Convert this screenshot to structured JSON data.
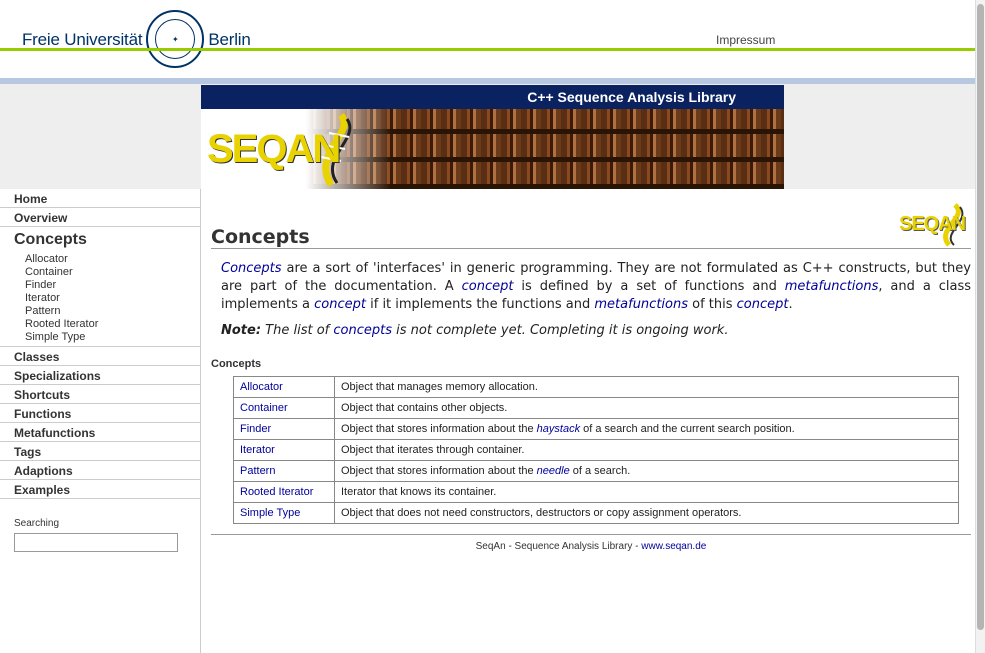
{
  "fu_header": {
    "university_left": "Freie Universität",
    "university_right": "Berlin",
    "impressum": "Impressum"
  },
  "banner": {
    "title": "C++ Sequence Analysis Library",
    "logo_text": "SEQAN"
  },
  "sidebar": {
    "items_top": [
      {
        "label": "Home"
      },
      {
        "label": "Overview"
      }
    ],
    "current": "Concepts",
    "sub_items": [
      {
        "label": "Allocator"
      },
      {
        "label": "Container"
      },
      {
        "label": "Finder"
      },
      {
        "label": "Iterator"
      },
      {
        "label": "Pattern"
      },
      {
        "label": "Rooted Iterator"
      },
      {
        "label": "Simple Type"
      }
    ],
    "items_bottom": [
      {
        "label": "Classes"
      },
      {
        "label": "Specializations"
      },
      {
        "label": "Shortcuts"
      },
      {
        "label": "Functions"
      },
      {
        "label": "Metafunctions"
      },
      {
        "label": "Tags"
      },
      {
        "label": "Adaptions"
      },
      {
        "label": "Examples"
      }
    ],
    "search_label": "Searching",
    "search_value": ""
  },
  "main": {
    "corner_logo": "SEQAN",
    "title": "Concepts",
    "intro": {
      "link_concepts": "Concepts",
      "t1": " are a sort of 'interfaces' in generic programming. They are not formulated as C++ constructs, but they are part of the documentation. A ",
      "link_concept": "concept",
      "t2": " is defined by a set of functions and ",
      "link_metafunctions": "metafunctions",
      "t3": ", and a class implements a ",
      "link_concept2": "concept",
      "t4": " if it implements the functions and ",
      "link_metafunctions2": "metafunctions",
      "t5": " of this ",
      "link_concept3": "concept",
      "t6": "."
    },
    "note": {
      "label": "Note:",
      "t1": " The list of ",
      "link": "concepts",
      "t2": " is not complete yet. Completing it is ongoing work."
    },
    "table_heading": "Concepts",
    "rows": [
      {
        "name": "Allocator",
        "desc_a": "Object that manages memory allocation.",
        "link": "",
        "desc_b": ""
      },
      {
        "name": "Container",
        "desc_a": "Object that contains other objects.",
        "link": "",
        "desc_b": ""
      },
      {
        "name": "Finder",
        "desc_a": "Object that stores information about the ",
        "link": "haystack",
        "desc_b": " of a search and the current search position."
      },
      {
        "name": "Iterator",
        "desc_a": "Object that iterates through container.",
        "link": "",
        "desc_b": ""
      },
      {
        "name": "Pattern",
        "desc_a": "Object that stores information about the ",
        "link": "needle",
        "desc_b": " of a search."
      },
      {
        "name": "Rooted Iterator",
        "desc_a": "Iterator that knows its container.",
        "link": "",
        "desc_b": ""
      },
      {
        "name": "Simple Type",
        "desc_a": "Object that does not need constructors, destructors or copy assignment operators.",
        "link": "",
        "desc_b": ""
      }
    ],
    "footer_text": "SeqAn - Sequence Analysis Library - ",
    "footer_link": "www.seqan.de"
  },
  "colors": {
    "fu_green": "#99cc00",
    "fu_blue_line": "#b8c8e0",
    "banner_navy": "#0b2260",
    "link_blue": "#000099",
    "logo_yellow": "#e8d200"
  }
}
